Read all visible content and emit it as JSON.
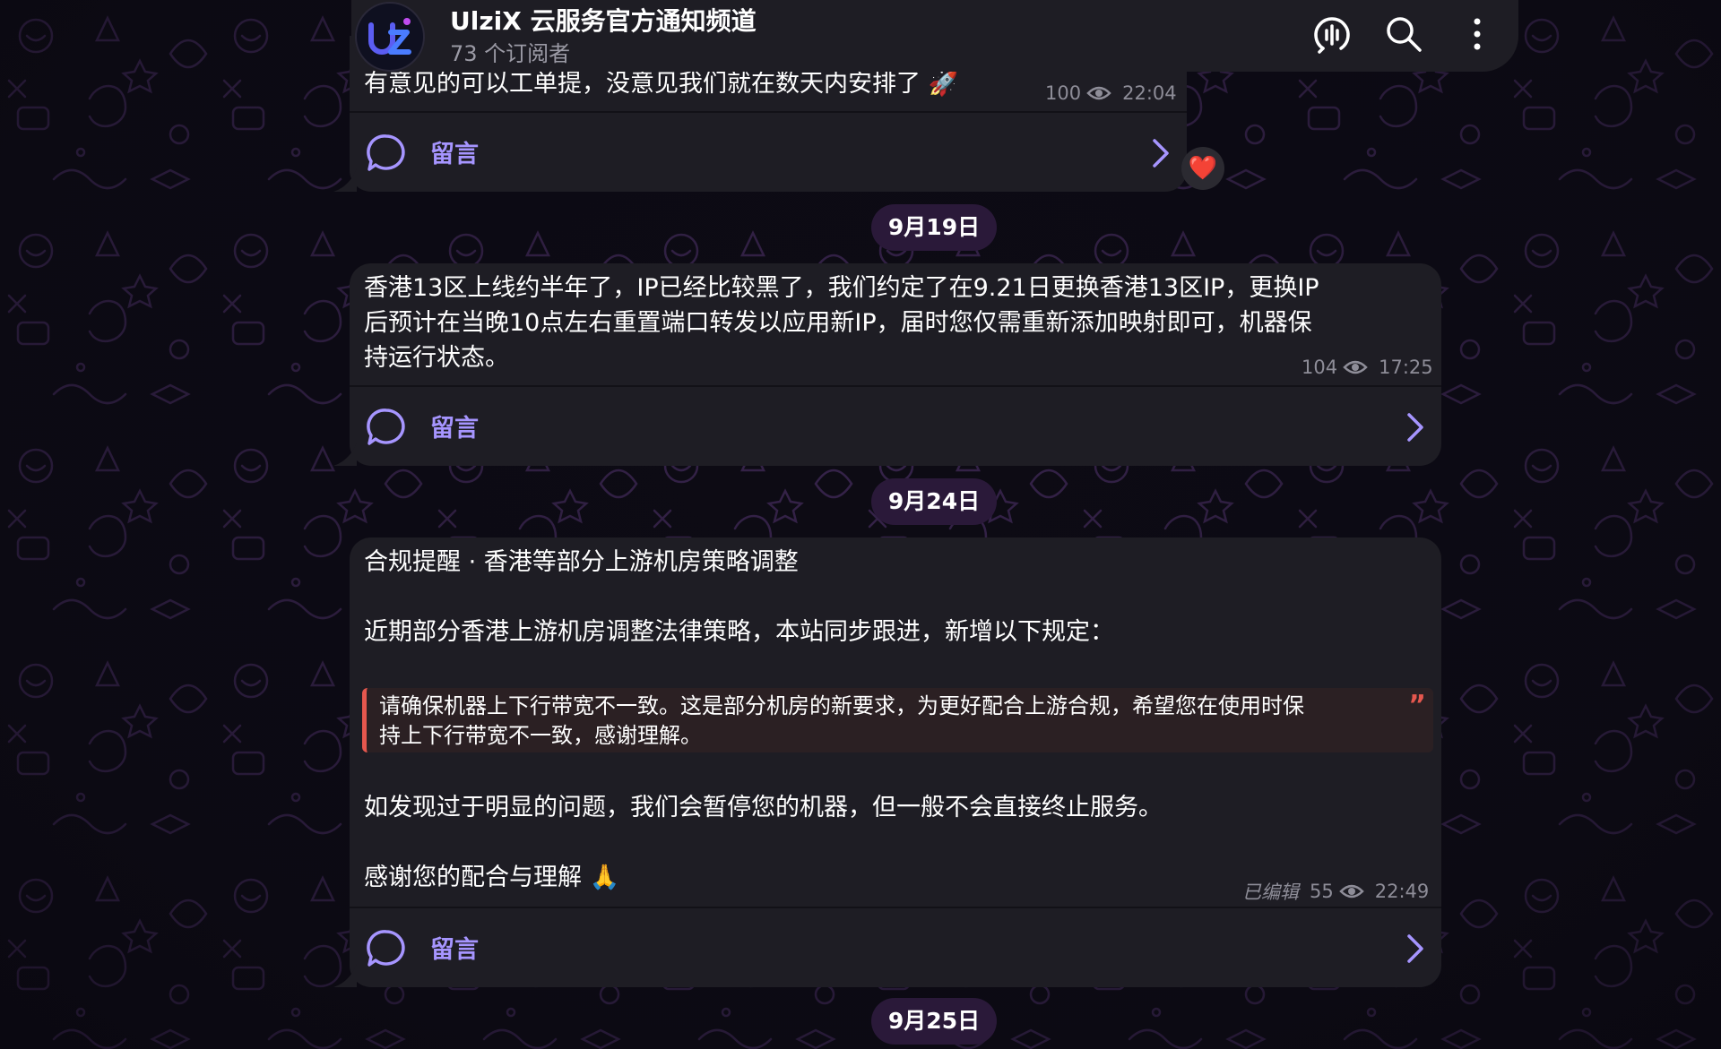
{
  "channel": {
    "title": "UlziX 云服务官方通知频道",
    "subscribers": "73 个订阅者",
    "logo_letters": "uz"
  },
  "header_icons": [
    "live-stream-icon",
    "search-icon",
    "more-vert-icon"
  ],
  "colors": {
    "accent": "#a695ff",
    "bubble": "#1e1d24",
    "date_pill": "#2a1939",
    "quote_bar": "#e5574e"
  },
  "messages": [
    {
      "text": "有意见的可以工单提，没意见我们就在数天内安排了 🚀",
      "views": "100",
      "time": "22:04",
      "comment_label": "留言",
      "reaction": "❤️"
    },
    {
      "date": "9月19日",
      "lines": [
        "香港13区上线约半年了，IP已经比较黑了，我们约定了在9.21日更换香港13区IP，更换IP",
        "后预计在当晚10点左右重置端口转发以应用新IP，届时您仅需重新添加映射即可，机器保",
        "持运行状态。"
      ],
      "views": "104",
      "time": "17:25",
      "comment_label": "留言"
    },
    {
      "date": "9月24日",
      "title": "合规提醒 · 香港等部分上游机房策略调整",
      "intro": "近期部分香港上游机房调整法律策略，本站同步跟进，新增以下规定：",
      "quote_lines": [
        "请确保机器上下行带宽不一致。这是部分机房的新要求，为更好配合上游合规，希望您在使用时保",
        "持上下行带宽不一致，感谢理解。"
      ],
      "para": "如发现过于明显的问题，我们会暂停您的机器，但一般不会直接终止服务。",
      "thanks": "感谢您的配合与理解 🙏",
      "edited": "已编辑",
      "views": "55",
      "time": "22:49",
      "comment_label": "留言"
    }
  ],
  "next_date": "9月25日"
}
